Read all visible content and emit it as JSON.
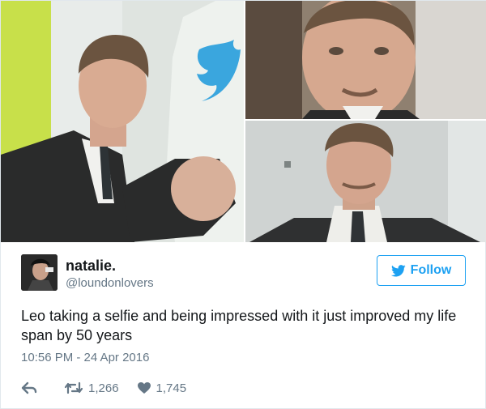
{
  "tweet": {
    "author_name": "natalie.",
    "author_handle": "@loundonlovers",
    "follow_label": "Follow",
    "text": "Leo taking a selfie and being impressed with it just improved my life span by 50 years",
    "timestamp": "10:56 PM - 24 Apr 2016",
    "retweet_count": "1,266",
    "like_count": "1,745"
  },
  "icons": {
    "follow": "twitter-bird-icon",
    "reply": "reply-icon",
    "retweet": "retweet-icon",
    "like": "heart-icon"
  },
  "colors": {
    "accent": "#1da1f2",
    "secondary_text": "#657786",
    "primary_text": "#14171a",
    "border": "#e1e8ed"
  }
}
